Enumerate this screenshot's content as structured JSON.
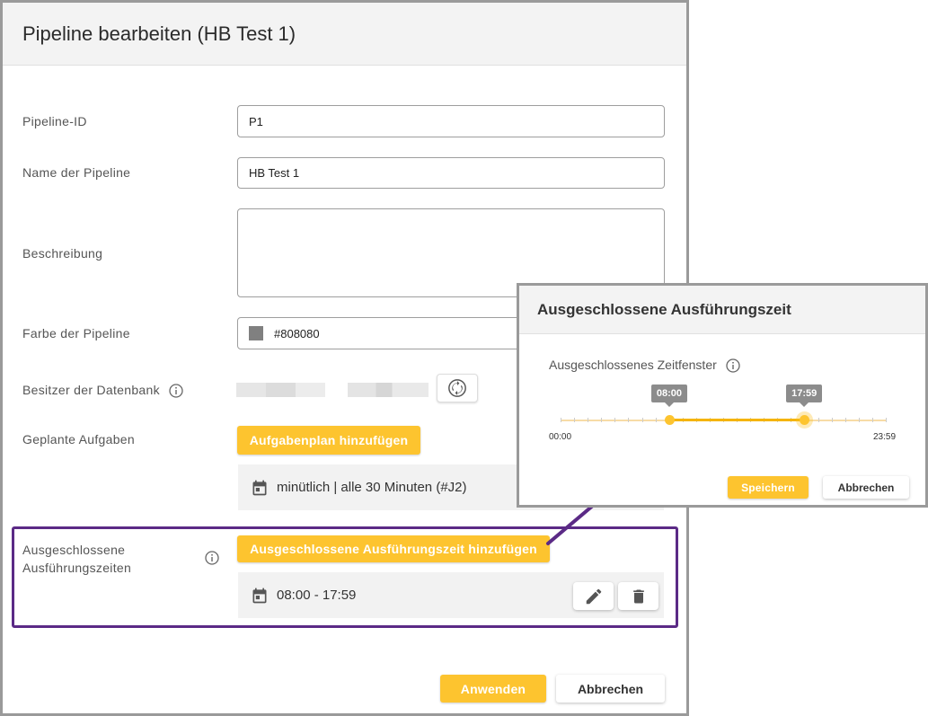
{
  "dialog": {
    "title": "Pipeline bearbeiten (HB Test 1)",
    "fields": {
      "pipeline_id": {
        "label": "Pipeline-ID",
        "value": "P1"
      },
      "name": {
        "label": "Name der Pipeline",
        "value": "HB Test 1"
      },
      "description": {
        "label": "Beschreibung",
        "value": ""
      },
      "color": {
        "label": "Farbe der Pipeline",
        "value": "#808080"
      },
      "db_owner": {
        "label": "Besitzer der Datenbank"
      },
      "scheduled_tasks": {
        "label": "Geplante Aufgaben"
      },
      "excluded_times": {
        "label_line1": "Ausgeschlossene",
        "label_line2": "Ausführungszeiten"
      }
    },
    "add_schedule_button": "Aufgabenplan hinzufügen",
    "schedule_entry": "minütlich | alle 30 Minuten (#J2)",
    "add_excluded_button": "Ausgeschlossene Ausführungszeit hinzufügen",
    "excluded_entry": "08:00 - 17:59",
    "apply_button": "Anwenden",
    "cancel_button": "Abbrechen"
  },
  "popup": {
    "title": "Ausgeschlossene Ausführungszeit",
    "subtitle": "Ausgeschlossenes Zeitfenster",
    "slider": {
      "min_label": "00:00",
      "max_label": "23:59",
      "start_label": "08:00",
      "end_label": "17:59",
      "start_fraction": 0.334,
      "end_fraction": 0.749
    },
    "save_button": "Speichern",
    "cancel_button": "Abbrechen"
  },
  "colors": {
    "accent": "#fdc42f",
    "highlight": "#5b2a86",
    "swatch": "#808080"
  }
}
